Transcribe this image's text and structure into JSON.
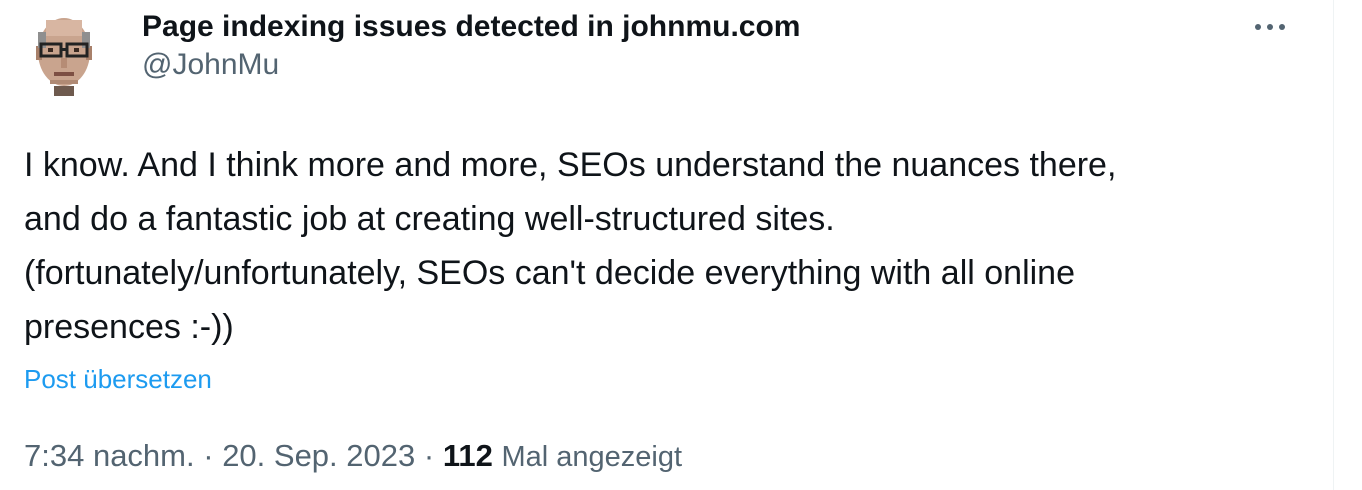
{
  "post": {
    "display_name": "Page indexing issues detected in johnmu.com",
    "handle": "@JohnMu",
    "more_icon": "more-horizontal-icon",
    "text_lines": [
      "I know. And I think more and more, SEOs understand the nuances there,",
      "and do a fantastic job at creating well-structured sites.",
      "(fortunately/unfortunately, SEOs can't decide everything with all online",
      "presences :-))"
    ],
    "translate_label": "Post übersetzen",
    "time": "7:34 nachm.",
    "separator": "·",
    "date": "20. Sep. 2023",
    "views_count": "112",
    "views_label": "Mal angezeigt"
  },
  "colors": {
    "text_primary": "#0f1419",
    "text_secondary": "#536471",
    "link": "#1d9bf0"
  }
}
